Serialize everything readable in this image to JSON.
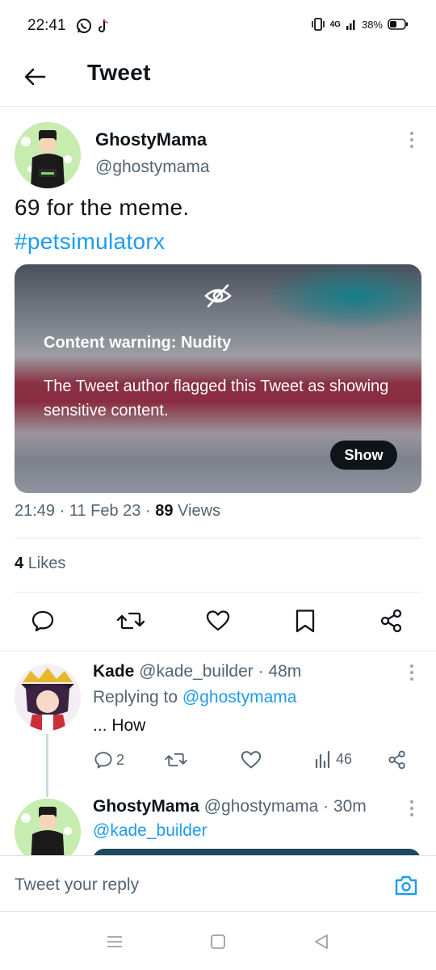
{
  "status_bar": {
    "time": "22:41",
    "network": "4G",
    "battery": "38%"
  },
  "header": {
    "title": "Tweet"
  },
  "tweet": {
    "author_name": "GhostyMama",
    "author_handle": "@ghostymama",
    "text": "69 for the meme.",
    "hashtag": "#petsimulatorx",
    "media_warning": {
      "title": "Content warning: Nudity",
      "body": "The Tweet author flagged this Tweet as showing sensitive content.",
      "show_label": "Show"
    },
    "time": "21:49",
    "date": "11 Feb 23",
    "views_count": "89",
    "views_label": "Views",
    "likes_count": "4",
    "likes_label": "Likes"
  },
  "replies": [
    {
      "author_name": "Kade",
      "author_handle": "@kade_builder",
      "age": "48m",
      "replying_prefix": "Replying to",
      "replying_to": "@ghostymama",
      "text": "... How",
      "reply_count": "2",
      "views_count": "46"
    },
    {
      "author_name": "GhostyMama",
      "author_handle": "@ghostymama",
      "age": "30m",
      "mention": "@kade_builder"
    }
  ],
  "composer": {
    "placeholder": "Tweet your reply"
  },
  "colors": {
    "accent": "#1d9bf0",
    "text_primary": "#0f1419",
    "text_secondary": "#536471"
  },
  "icons": {
    "back": "arrow-left-icon",
    "eye_off": "eye-off-icon",
    "reply": "reply-icon",
    "retweet": "retweet-icon",
    "like": "heart-icon",
    "bookmark": "bookmark-icon",
    "share": "share-icon",
    "views": "bar-chart-icon",
    "camera": "camera-icon"
  }
}
